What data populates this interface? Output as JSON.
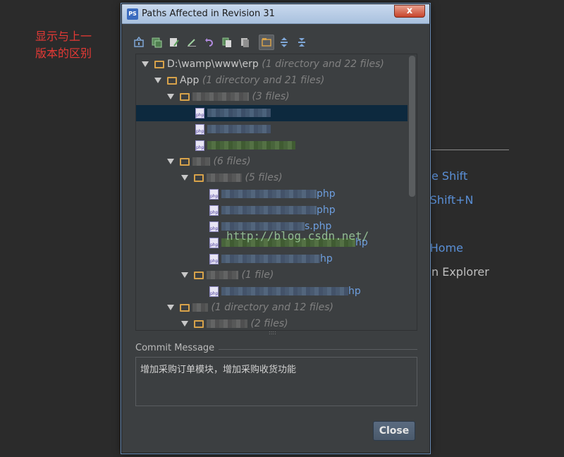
{
  "annotation": {
    "line1": "显示与上一",
    "line2": "版本的区别"
  },
  "background": {
    "items": [
      {
        "text": "e Shift",
        "color": "#5a8fd6"
      },
      {
        "text": "-Shift+N",
        "color": "#5a8fd6"
      },
      {
        "text": "-Home",
        "color": "#5a8fd6"
      },
      {
        "text": "n Explorer",
        "color": "#bfbfbf"
      }
    ]
  },
  "dialog": {
    "title": "Paths Affected in Revision 31",
    "close_glyph": "x",
    "toolbar": [
      {
        "icon": "diff-with-previous-icon"
      },
      {
        "icon": "add-to-changelist-icon"
      },
      {
        "icon": "edit-source-icon"
      },
      {
        "icon": "edit-icon"
      },
      {
        "icon": "revert-icon"
      },
      {
        "icon": "compare-icon"
      },
      {
        "icon": "copy-icon"
      },
      {
        "icon": "group-by-directory-icon"
      },
      {
        "icon": "expand-all-icon"
      },
      {
        "icon": "collapse-all-icon"
      }
    ],
    "tree": {
      "root": {
        "name": "D:\\wamp\\www\\erp",
        "meta": "(1 directory and 22 files)"
      },
      "app": {
        "name": "App",
        "meta": "(1 directory and 21 files)"
      },
      "folder1_meta": "(3 files)",
      "folder2_meta": "(6 files)",
      "folder3_meta": "(5 files)",
      "file_php_1": "php",
      "file_php_2": "php",
      "file_php_3": "s.php",
      "file_php_4": "hp",
      "file_php_5": "hp",
      "folder4_meta": "(1 file)",
      "file_php_6": "hp",
      "folder5_meta": "(1 directory and 12 files)",
      "folder6_meta": "(2 files)",
      "watermark": "http://blog.csdn.net/"
    },
    "commit_label": "Commit Message",
    "commit_message": "增加采购订单模块，增加采购收货功能",
    "close_button": "Close"
  }
}
